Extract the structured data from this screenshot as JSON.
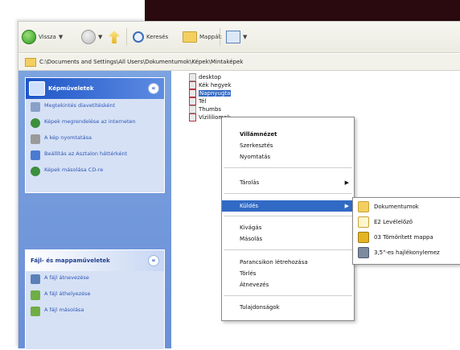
{
  "toolbar": {
    "back_label": "Vissza",
    "search_label": "Keresés",
    "folders_label": "Mappák"
  },
  "address": {
    "path": "C:\\Documents and Settings\\All Users\\Dokumentumok\\Képek\\Mintaképek"
  },
  "task_pane": {
    "picture_tasks": {
      "title": "Képműveletek",
      "items": [
        {
          "label": "Megtekintés diavetítésként",
          "icon": "slideshow-icon"
        },
        {
          "label": "Képek megrendelése az interneten",
          "icon": "order-prints-icon"
        },
        {
          "label": "A kép nyomtatása",
          "icon": "print-icon"
        },
        {
          "label": "Beállítás az Asztalon háttérként",
          "icon": "desktop-background-icon"
        },
        {
          "label": "Képek másolása CD-re",
          "icon": "cd-copy-icon"
        }
      ]
    },
    "file_tasks": {
      "title": "Fájl- és mappaműveletek",
      "items": [
        {
          "label": "A fájl átnevezése",
          "icon": "rename-icon"
        },
        {
          "label": "A fájl áthelyezése",
          "icon": "move-icon"
        },
        {
          "label": "A fájl másolása",
          "icon": "copy-icon"
        }
      ]
    }
  },
  "files": [
    {
      "name": "desktop",
      "type": "file"
    },
    {
      "name": "Kék hegyek",
      "type": "image"
    },
    {
      "name": "Napnyugta",
      "type": "image",
      "selected": true
    },
    {
      "name": "Tél",
      "type": "image"
    },
    {
      "name": "Thumbs",
      "type": "file"
    },
    {
      "name": "Vízililiomok",
      "type": "image"
    }
  ],
  "context_menu": {
    "groups": [
      [
        {
          "label": "Villámnézet",
          "bold": true
        },
        {
          "label": "Szerkesztés"
        },
        {
          "label": "Nyomtatás"
        }
      ],
      [
        {
          "label": "Tárolás",
          "submenu": true
        }
      ],
      [
        {
          "label": "Küldés",
          "submenu": true,
          "highlighted": true
        }
      ],
      [
        {
          "label": "Kivágás"
        },
        {
          "label": "Másolás"
        }
      ],
      [
        {
          "label": "Parancsikon létrehozása"
        },
        {
          "label": "Törlés"
        },
        {
          "label": "Átnevezés"
        }
      ],
      [
        {
          "label": "Tulajdonságok"
        }
      ]
    ]
  },
  "send_to_menu": [
    {
      "label": "Dokumentumok",
      "icon": "documents-icon"
    },
    {
      "label": "E2 Levélelőző",
      "icon": "mail-recipient-icon"
    },
    {
      "label": "03 Tömörített mappa",
      "icon": "compressed-folder-icon"
    },
    {
      "label": "3,5\"-es hajlékonylemez",
      "icon": "floppy-icon"
    }
  ],
  "colors": {
    "selection": "#316ac5",
    "task_pane": "#6b8fd8",
    "panel_header": "#1f56c8",
    "background_dark": "#2a0a0e"
  }
}
